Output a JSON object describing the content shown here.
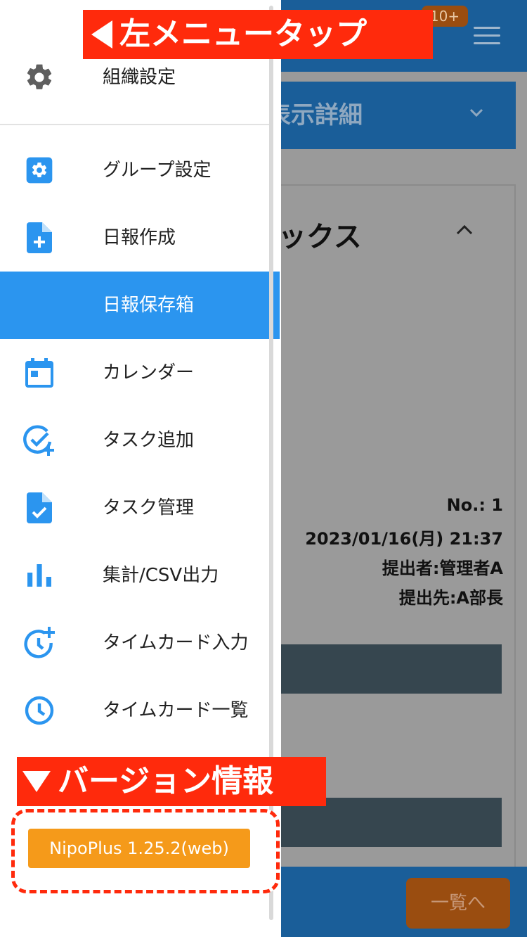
{
  "background": {
    "notification_badge": "10+",
    "view_bar_title": "表示詳細",
    "card_title": "ックス",
    "report_no": "No.: 1",
    "report_datetime": "2023/01/16(月) 21:37",
    "submitter": "提出者:管理者A",
    "recipient": "提出先:A部長",
    "list_button": "一覧へ"
  },
  "drawer": {
    "top_item": {
      "label": "組織設定",
      "icon": "gear-icon"
    },
    "items": [
      {
        "label": "グループ設定",
        "icon": "gear-square-icon",
        "active": false
      },
      {
        "label": "日報作成",
        "icon": "file-plus-icon",
        "active": false
      },
      {
        "label": "日報保存箱",
        "icon": "inbox-icon",
        "active": true
      },
      {
        "label": "カレンダー",
        "icon": "calendar-icon",
        "active": false
      },
      {
        "label": "タスク追加",
        "icon": "check-circle-plus-icon",
        "active": false
      },
      {
        "label": "タスク管理",
        "icon": "file-check-icon",
        "active": false
      },
      {
        "label": "集計/CSV出力",
        "icon": "bar-chart-icon",
        "active": false
      },
      {
        "label": "タイムカード入力",
        "icon": "clock-plus-icon",
        "active": false
      },
      {
        "label": "タイムカード一覧",
        "icon": "clock-icon",
        "active": false
      }
    ],
    "version": "NipoPlus 1.25.2(web)"
  },
  "annotations": {
    "left_menu_tap": "左メニュータップ",
    "version_info": "バージョン情報"
  },
  "colors": {
    "accent_blue": "#2b95ef",
    "header_blue": "#1a5e99",
    "annotation_red": "#ff2a0c",
    "version_orange": "#f59a1a"
  }
}
